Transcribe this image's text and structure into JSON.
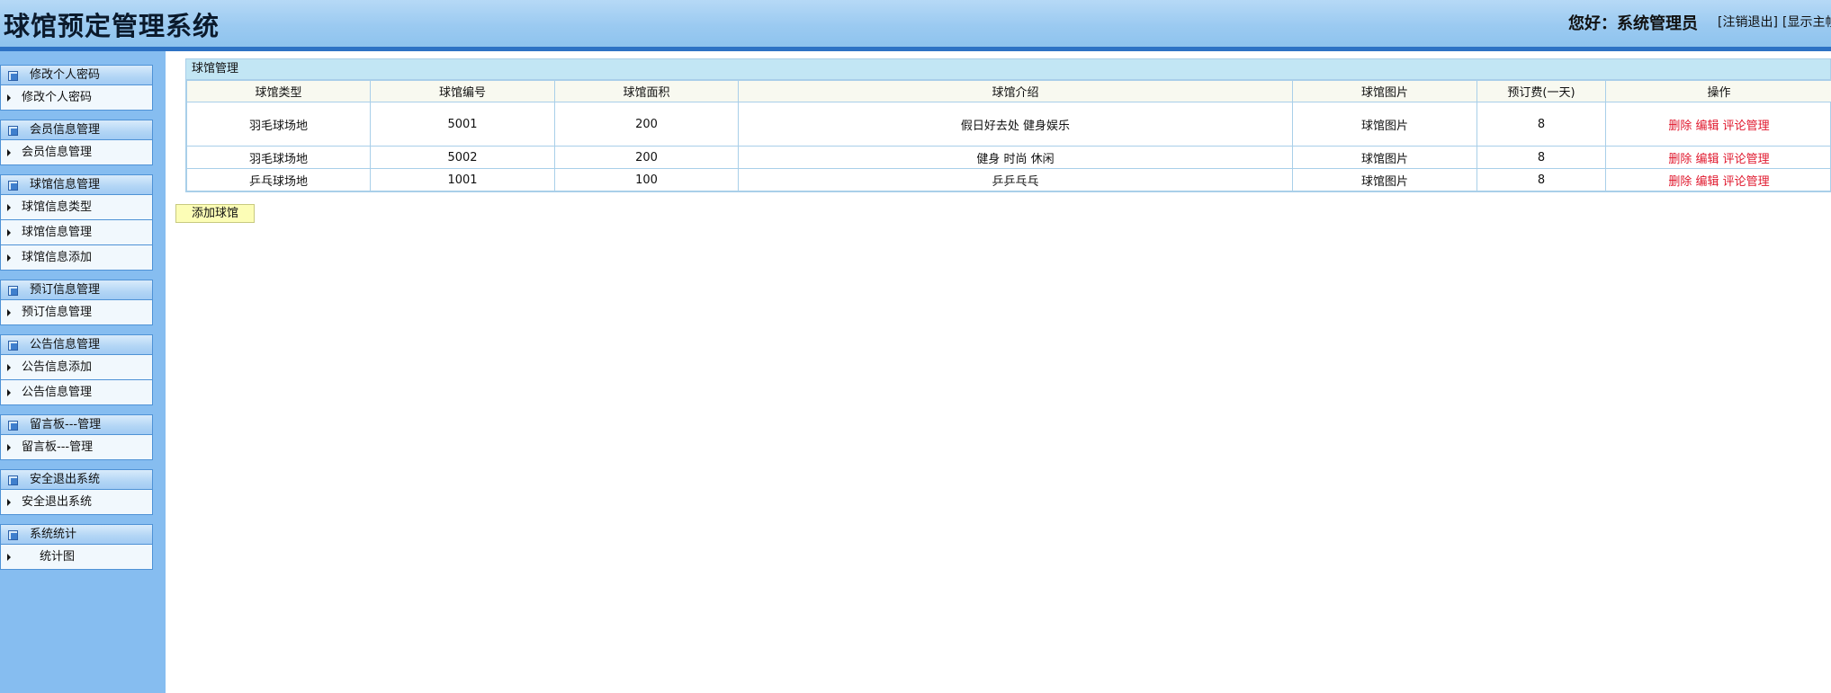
{
  "header": {
    "title": "球馆预定管理系统",
    "greeting": "您好：系统管理员",
    "logout_link": "[注销退出]",
    "home_link": "[显示主帧"
  },
  "sidebar": {
    "groups": [
      {
        "title": "修改个人密码",
        "items": [
          "修改个人密码"
        ]
      },
      {
        "title": "会员信息管理",
        "items": [
          "会员信息管理"
        ]
      },
      {
        "title": "球馆信息管理",
        "items": [
          "球馆信息类型",
          "球馆信息管理",
          "球馆信息添加"
        ]
      },
      {
        "title": "预订信息管理",
        "items": [
          "预订信息管理"
        ]
      },
      {
        "title": "公告信息管理",
        "items": [
          "公告信息添加",
          "公告信息管理"
        ]
      },
      {
        "title": "留言板---管理",
        "items": [
          "留言板---管理"
        ]
      },
      {
        "title": "安全退出系统",
        "items": [
          "安全退出系统"
        ]
      },
      {
        "title": "系统统计",
        "items": [
          "统计图"
        ]
      }
    ]
  },
  "panel": {
    "title": "球馆管理",
    "columns": [
      "球馆类型",
      "球馆编号",
      "球馆面积",
      "球馆介绍",
      "球馆图片",
      "预订费(一天)",
      "操作"
    ],
    "rows": [
      {
        "type": "羽毛球场地",
        "id": "5001",
        "area": "200",
        "intro": "假日好去处 健身娱乐",
        "image": "球馆图片",
        "fee": "8"
      },
      {
        "type": "羽毛球场地",
        "id": "5002",
        "area": "200",
        "intro": "健身 时尚 休闲",
        "image": "球馆图片",
        "fee": "8"
      },
      {
        "type": "乒乓球场地",
        "id": "1001",
        "area": "100",
        "intro": "乒乒乓乓",
        "image": "球馆图片",
        "fee": "8"
      }
    ],
    "actions": {
      "delete": "删除",
      "edit": "编辑",
      "comments": "评论管理"
    }
  },
  "add_button": {
    "label": "添加球馆"
  }
}
